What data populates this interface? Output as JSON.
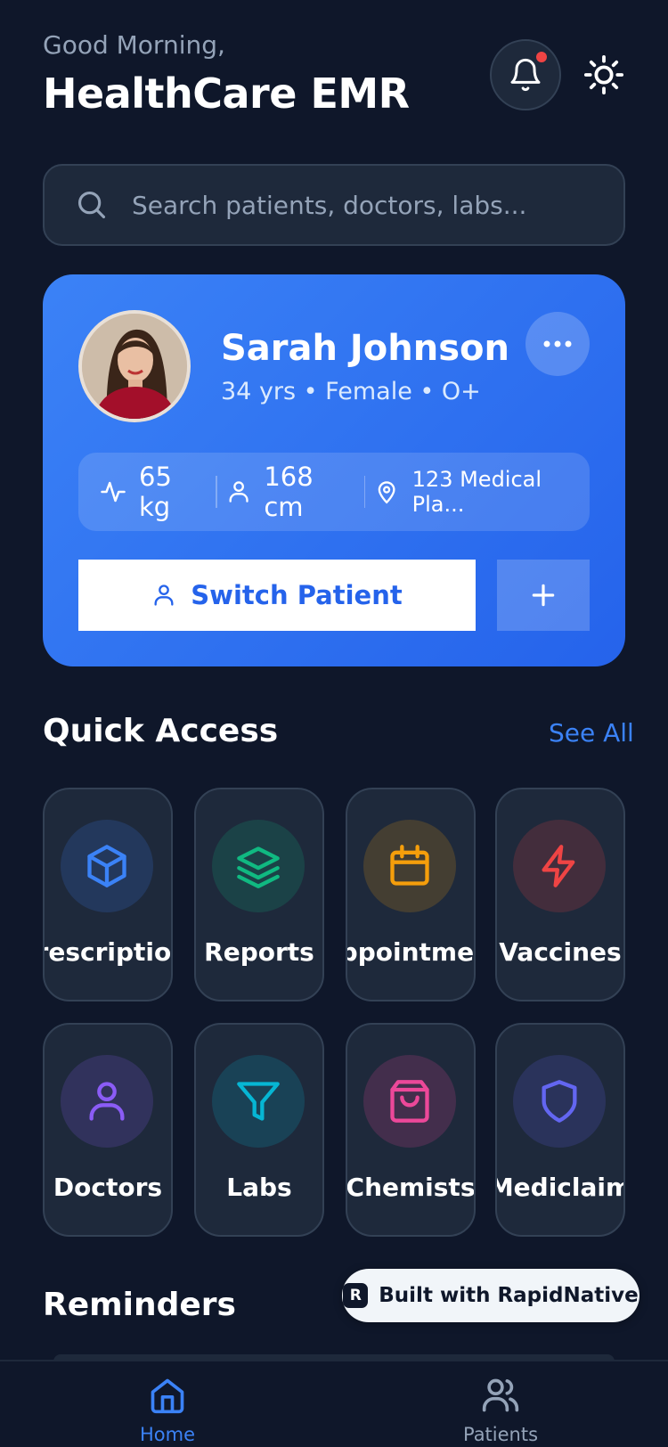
{
  "header": {
    "greeting": "Good Morning,",
    "title": "HealthCare EMR",
    "bell_icon": "bell-icon",
    "theme_icon": "sun-icon"
  },
  "search": {
    "placeholder": "Search patients, doctors, labs..."
  },
  "patient": {
    "name": "Sarah Johnson",
    "meta": "34 yrs • Female • O+",
    "weight": "65 kg",
    "height": "168 cm",
    "address": "123 Medical Pla...",
    "switch_label": "Switch Patient",
    "add_label": "+"
  },
  "quick_access": {
    "title": "Quick Access",
    "see_all": "See All",
    "items": [
      {
        "label": "Prescriptions",
        "icon": "box-icon",
        "color": "#3b82f6"
      },
      {
        "label": "Reports",
        "icon": "layers-icon",
        "color": "#10b981"
      },
      {
        "label": "Appointments",
        "icon": "calendar-icon",
        "color": "#f59e0b"
      },
      {
        "label": "Vaccines",
        "icon": "lightning-icon",
        "color": "#ef4444"
      },
      {
        "label": "Doctors",
        "icon": "user-icon",
        "color": "#8b5cf6"
      },
      {
        "label": "Labs",
        "icon": "filter-icon",
        "color": "#06b6d4"
      },
      {
        "label": "Chemists",
        "icon": "shopping-bag-icon",
        "color": "#ec4899"
      },
      {
        "label": "Mediclaim",
        "icon": "shield-icon",
        "color": "#6366f1"
      }
    ]
  },
  "reminders": {
    "title": "Reminders"
  },
  "badge": {
    "label": "Built with RapidNative"
  },
  "tabs": [
    {
      "label": "Home",
      "icon": "home-icon",
      "active": true
    },
    {
      "label": "Patients",
      "icon": "users-icon",
      "active": false
    }
  ],
  "colors": {
    "background": "#0f172a",
    "surface": "#1e293b",
    "accent": "#3b82f6",
    "notification": "#ef4444"
  }
}
